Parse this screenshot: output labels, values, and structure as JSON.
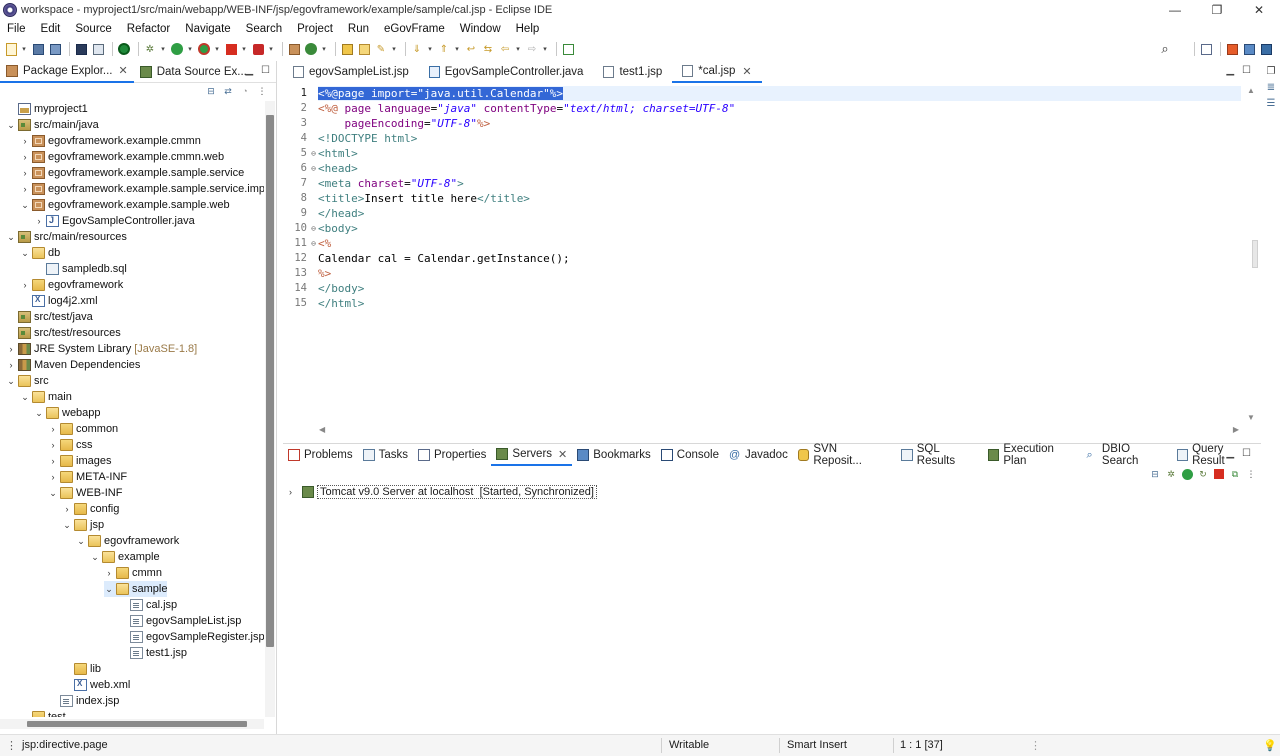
{
  "window": {
    "title": "workspace - myproject1/src/main/webapp/WEB-INF/jsp/egovframework/example/sample/cal.jsp - Eclipse IDE",
    "controls": [
      "—",
      "❐",
      "✕"
    ]
  },
  "menu": [
    "File",
    "Edit",
    "Source",
    "Refactor",
    "Navigate",
    "Search",
    "Project",
    "Run",
    "eGovFrame",
    "Window",
    "Help"
  ],
  "left_panel": {
    "tabs": [
      {
        "label": "Package Explor...",
        "icon": "package-explorer-icon",
        "closable": true
      },
      {
        "label": "Data Source Ex...",
        "icon": "data-source-icon",
        "closable": false
      }
    ],
    "tree": [
      {
        "label": "myproject1",
        "depth": 0,
        "expand": "",
        "icon": "project"
      },
      {
        "label": "src/main/java",
        "depth": 0,
        "expand": "open",
        "icon": "srcfolder"
      },
      {
        "label": "egovframework.example.cmmn",
        "depth": 1,
        "expand": "closed",
        "icon": "pkg"
      },
      {
        "label": "egovframework.example.cmmn.web",
        "depth": 1,
        "expand": "closed",
        "icon": "pkg"
      },
      {
        "label": "egovframework.example.sample.service",
        "depth": 1,
        "expand": "closed",
        "icon": "pkg"
      },
      {
        "label": "egovframework.example.sample.service.impl",
        "depth": 1,
        "expand": "closed",
        "icon": "pkg"
      },
      {
        "label": "egovframework.example.sample.web",
        "depth": 1,
        "expand": "open",
        "icon": "pkg"
      },
      {
        "label": "EgovSampleController.java",
        "depth": 2,
        "expand": "closed",
        "icon": "java"
      },
      {
        "label": "src/main/resources",
        "depth": 0,
        "expand": "open",
        "icon": "srcfolder"
      },
      {
        "label": "db",
        "depth": 1,
        "expand": "open",
        "icon": "folder-open"
      },
      {
        "label": "sampledb.sql",
        "depth": 2,
        "expand": "",
        "icon": "sql"
      },
      {
        "label": "egovframework",
        "depth": 1,
        "expand": "closed",
        "icon": "folder"
      },
      {
        "label": "log4j2.xml",
        "depth": 1,
        "expand": "",
        "icon": "xml"
      },
      {
        "label": "src/test/java",
        "depth": 0,
        "expand": "",
        "icon": "srcfolder"
      },
      {
        "label": "src/test/resources",
        "depth": 0,
        "expand": "",
        "icon": "srcfolder"
      },
      {
        "label": "JRE System Library",
        "decoration": "[JavaSE-1.8]",
        "depth": 0,
        "expand": "closed",
        "icon": "lib"
      },
      {
        "label": "Maven Dependencies",
        "depth": 0,
        "expand": "closed",
        "icon": "lib"
      },
      {
        "label": "src",
        "depth": 0,
        "expand": "open",
        "icon": "folder-open"
      },
      {
        "label": "main",
        "depth": 1,
        "expand": "open",
        "icon": "folder-open"
      },
      {
        "label": "webapp",
        "depth": 2,
        "expand": "open",
        "icon": "folder-open"
      },
      {
        "label": "common",
        "depth": 3,
        "expand": "closed",
        "icon": "folder"
      },
      {
        "label": "css",
        "depth": 3,
        "expand": "closed",
        "icon": "folder"
      },
      {
        "label": "images",
        "depth": 3,
        "expand": "closed",
        "icon": "folder"
      },
      {
        "label": "META-INF",
        "depth": 3,
        "expand": "closed",
        "icon": "folder"
      },
      {
        "label": "WEB-INF",
        "depth": 3,
        "expand": "open",
        "icon": "folder-open"
      },
      {
        "label": "config",
        "depth": 4,
        "expand": "closed",
        "icon": "folder"
      },
      {
        "label": "jsp",
        "depth": 4,
        "expand": "open",
        "icon": "folder-open"
      },
      {
        "label": "egovframework",
        "depth": 5,
        "expand": "open",
        "icon": "folder-open"
      },
      {
        "label": "example",
        "depth": 6,
        "expand": "open",
        "icon": "folder-open"
      },
      {
        "label": "cmmn",
        "depth": 7,
        "expand": "closed",
        "icon": "folder"
      },
      {
        "label": "sample",
        "depth": 7,
        "expand": "open",
        "icon": "folder-open",
        "selected": true
      },
      {
        "label": "cal.jsp",
        "depth": 8,
        "expand": "",
        "icon": "jsp"
      },
      {
        "label": "egovSampleList.jsp",
        "depth": 8,
        "expand": "",
        "icon": "jsp"
      },
      {
        "label": "egovSampleRegister.jsp",
        "depth": 8,
        "expand": "",
        "icon": "jsp"
      },
      {
        "label": "test1.jsp",
        "depth": 8,
        "expand": "",
        "icon": "jsp"
      },
      {
        "label": "lib",
        "depth": 4,
        "expand": "",
        "icon": "folder"
      },
      {
        "label": "web.xml",
        "depth": 4,
        "expand": "",
        "icon": "xml"
      },
      {
        "label": "index.jsp",
        "depth": 3,
        "expand": "",
        "icon": "jsp"
      },
      {
        "label": "test",
        "depth": 1,
        "expand": "",
        "icon": "folder"
      }
    ]
  },
  "editor": {
    "tabs": [
      {
        "label": "egovSampleList.jsp",
        "active": false
      },
      {
        "label": "EgovSampleController.java",
        "active": false
      },
      {
        "label": "test1.jsp",
        "active": false
      },
      {
        "label": "*cal.jsp",
        "active": true
      }
    ],
    "lines": [
      {
        "n": "1",
        "fold": "",
        "tokens": [
          [
            "sel",
            "<%@page import=\"java.util.Calendar\"%>"
          ]
        ],
        "current": true
      },
      {
        "n": "2",
        "fold": "",
        "tokens": [
          [
            "tok-dir",
            "<%@ "
          ],
          [
            "tok-attr",
            "page "
          ],
          [
            "tok-attr",
            "language"
          ],
          [
            "tok-plain",
            "="
          ],
          [
            "tok-str",
            "\"java\""
          ],
          [
            "tok-plain",
            " "
          ],
          [
            "tok-attr",
            "contentType"
          ],
          [
            "tok-plain",
            "="
          ],
          [
            "tok-str",
            "\"text/html; charset=UTF-8\""
          ]
        ]
      },
      {
        "n": "3",
        "fold": "",
        "tokens": [
          [
            "tok-plain",
            "    "
          ],
          [
            "tok-attr",
            "pageEncoding"
          ],
          [
            "tok-plain",
            "="
          ],
          [
            "tok-str",
            "\"UTF-8\""
          ],
          [
            "tok-dir",
            "%>"
          ]
        ]
      },
      {
        "n": "4",
        "fold": "",
        "tokens": [
          [
            "tok-tag",
            "<!DOCTYPE html>"
          ]
        ]
      },
      {
        "n": "5",
        "fold": "⊖",
        "tokens": [
          [
            "tok-tag",
            "<html>"
          ]
        ]
      },
      {
        "n": "6",
        "fold": "⊖",
        "tokens": [
          [
            "tok-tag",
            "<head>"
          ]
        ]
      },
      {
        "n": "7",
        "fold": "",
        "tokens": [
          [
            "tok-tag",
            "<meta "
          ],
          [
            "tok-attr",
            "charset"
          ],
          [
            "tok-plain",
            "="
          ],
          [
            "tok-str",
            "\"UTF-8\""
          ],
          [
            "tok-tag",
            ">"
          ]
        ]
      },
      {
        "n": "8",
        "fold": "",
        "tokens": [
          [
            "tok-tag",
            "<title>"
          ],
          [
            "tok-plain",
            "Insert title here"
          ],
          [
            "tok-tag",
            "</title>"
          ]
        ]
      },
      {
        "n": "9",
        "fold": "",
        "tokens": [
          [
            "tok-tag",
            "</head>"
          ]
        ]
      },
      {
        "n": "10",
        "fold": "⊖",
        "tokens": [
          [
            "tok-tag",
            "<body>"
          ]
        ]
      },
      {
        "n": "11",
        "fold": "⊖",
        "tokens": [
          [
            "tok-dir",
            "<%"
          ]
        ]
      },
      {
        "n": "12",
        "fold": "",
        "tokens": [
          [
            "tok-plain",
            "Calendar cal = Calendar.getInstance();"
          ]
        ]
      },
      {
        "n": "13",
        "fold": "",
        "tokens": [
          [
            "tok-dir",
            "%>"
          ]
        ]
      },
      {
        "n": "14",
        "fold": "",
        "tokens": [
          [
            "tok-tag",
            "</body>"
          ]
        ]
      },
      {
        "n": "15",
        "fold": "",
        "tokens": [
          [
            "tok-tag",
            "</html>"
          ]
        ]
      }
    ]
  },
  "bottom_panel": {
    "tabs": [
      {
        "label": "Problems",
        "active": false
      },
      {
        "label": "Tasks",
        "active": false
      },
      {
        "label": "Properties",
        "active": false
      },
      {
        "label": "Servers",
        "active": true
      },
      {
        "label": "Bookmarks",
        "active": false
      },
      {
        "label": "Console",
        "active": false
      },
      {
        "label": "Javadoc",
        "active": false
      },
      {
        "label": "SVN Reposit...",
        "active": false
      },
      {
        "label": "SQL Results",
        "active": false
      },
      {
        "label": "Execution Plan",
        "active": false
      },
      {
        "label": "DBIO Search",
        "active": false
      },
      {
        "label": "Query Result",
        "active": false
      }
    ],
    "server": "Tomcat v9.0 Server at localhost  [Started, Synchronized]"
  },
  "status": {
    "context": "jsp:directive.page",
    "writable": "Writable",
    "insert_mode": "Smart Insert",
    "position": "1 : 1 [37]"
  },
  "colors": {
    "accent": "#1a73e8",
    "selection": "#3367d6",
    "current_line": "#e8f2fe"
  }
}
